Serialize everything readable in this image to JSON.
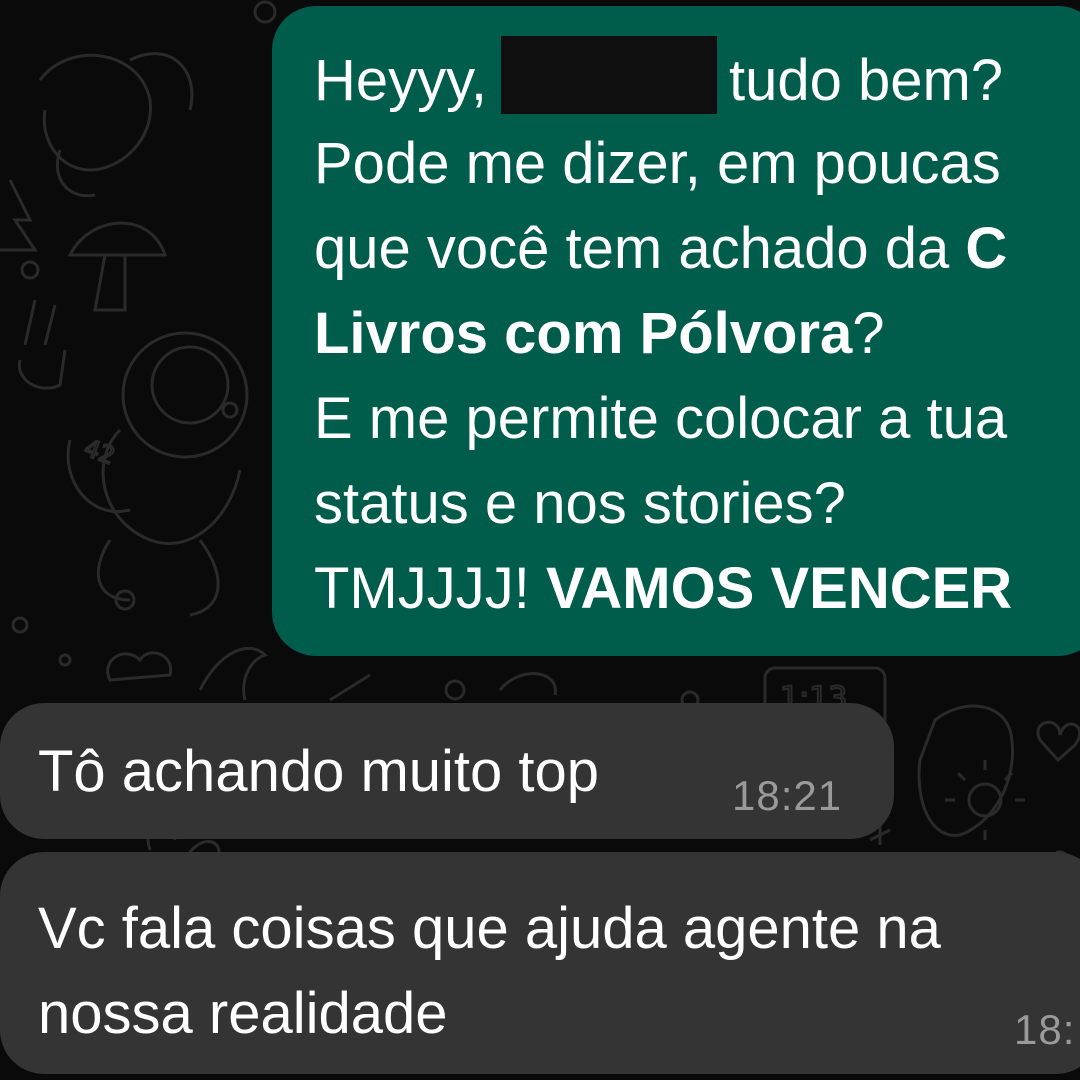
{
  "conversation": {
    "messages": [
      {
        "direction": "outgoing",
        "greeting_start": "Heyyy,",
        "greeting_end": "tudo bem?",
        "line2": "Pode me dizer, em poucas",
        "line3_start": "que você tem achado da",
        "line3_bold": "C",
        "line4_bold": "Livros com Pólvora",
        "line4_end": "?",
        "line5": "E me permite colocar a tua",
        "line6": "status e nos stories?",
        "line7_start": "TMJJJJ!",
        "line7_bold": "VAMOS VENCER"
      },
      {
        "direction": "incoming",
        "text": "Tô achando muito top",
        "time": "18:21"
      },
      {
        "direction": "incoming",
        "line1": "Vc fala coisas que ajuda agente na",
        "line2": "nossa realidade",
        "time": "18:"
      }
    ]
  },
  "colors": {
    "background": "#0a0a0a",
    "outgoing_bubble": "#005c4b",
    "incoming_bubble": "#343434",
    "timestamp": "#9a9a9a"
  }
}
